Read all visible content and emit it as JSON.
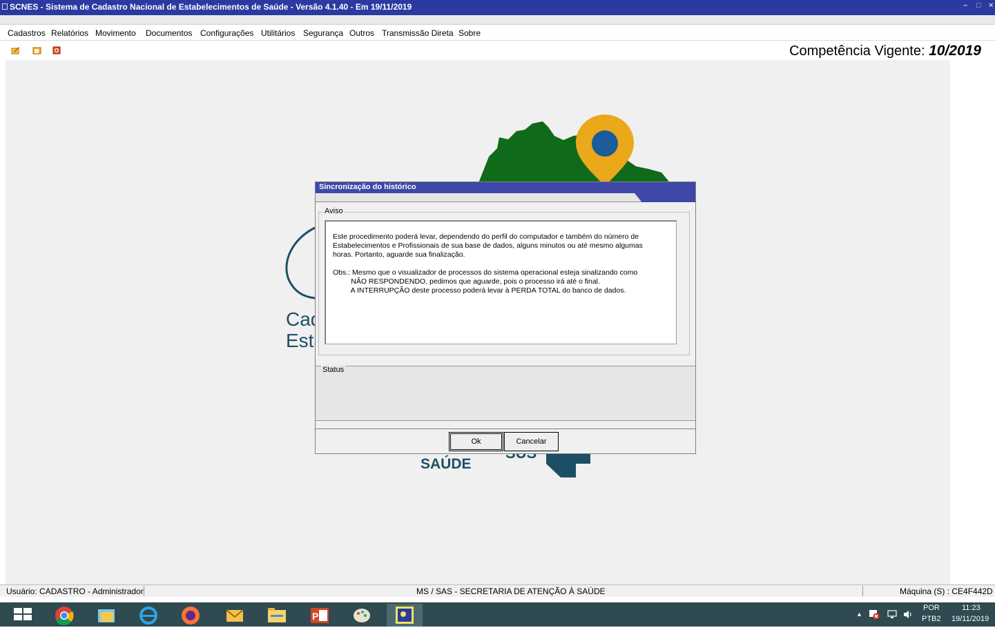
{
  "window": {
    "title": "SCNES - Sistema de Cadastro Nacional de Estabelecimentos de Saúde - Versão 4.1.40  -  Em 19/11/2019",
    "minimize": "–",
    "maximize": "□",
    "close": "×"
  },
  "menu": {
    "items": [
      "Cadastros",
      "Relatórios",
      "Movimento",
      "Documentos",
      "Configurações",
      "Utilitários",
      "Segurança",
      "Outros",
      "Transmissão Direta",
      "Sobre"
    ]
  },
  "header": {
    "competencia_label": "Competência Vigente:",
    "competencia_value": "10/2019"
  },
  "background_logo": {
    "text_line1": "Cad",
    "text_line2": "Esta",
    "ministerio": "SAÚDE",
    "sus": "SUS"
  },
  "dialog": {
    "title": "Sincronização do histórico",
    "aviso_label": "Aviso",
    "message_lines": [
      "Este procedimento poderá levar, dependendo do perfil  do computador e também do número de",
      "Estabelecimentos e Profissionais de sua base de dados, alguns minutos ou até mesmo algumas",
      "horas. Portanto, aguarde sua finalização.",
      "",
      "Obs.: Mesmo que o visualizador de processos do sistema operacional esteja sinalizando como",
      "         NÃO RESPONDENDO, pedimos que aguarde, pois o processo irá até o final.",
      "         A INTERRUPÇÃO deste processo poderá levar à PERDA TOTAL do banco de dados."
    ],
    "status_label": "Status",
    "ok_label": "Ok",
    "cancel_label": "Cancelar"
  },
  "statusbar": {
    "user": "Usuário: CADASTRO - Administrador",
    "org": "MS / SAS - SECRETARIA DE ATENÇÃO À SAÚDE",
    "machine": "Máquina (S) : CE4F442D"
  },
  "taskbar": {
    "lang": "POR",
    "lang2": "PTB2",
    "time": "11:23",
    "date": "19/11/2019",
    "tray_arrow": "▲"
  },
  "colors": {
    "titlebar": "#2b3aa0",
    "dialog_title": "#3f47a8",
    "map_green": "#0f6a1a",
    "pin_orange": "#eaa81a",
    "pin_blue": "#1b5c99",
    "logo_teal": "#1d4f64",
    "taskbar": "#2f4a50"
  }
}
